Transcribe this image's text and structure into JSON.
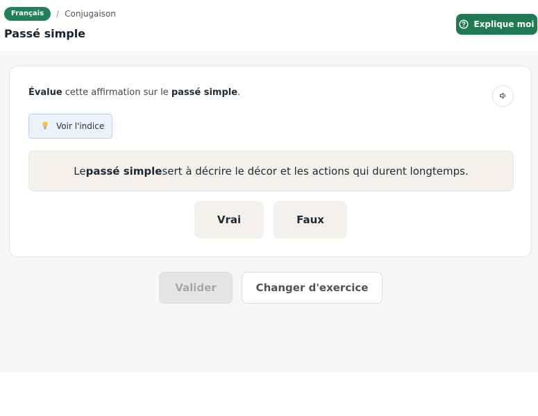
{
  "header": {
    "breadcrumb": {
      "subject": "Français",
      "separator": "/",
      "current": "Conjugaison"
    },
    "title": "Passé simple",
    "explain_button": {
      "label": "Explique moi",
      "icon": "help-circle-icon"
    }
  },
  "exercise": {
    "instruction": {
      "part1": "Évalue",
      "part2": " cette affirmation sur le ",
      "part3": "passé simple",
      "part4": "."
    },
    "audio_button": {
      "icon": "speaker-icon"
    },
    "hint_button": {
      "label": "Voir l'indice",
      "icon": "lightbulb-icon"
    },
    "statement": {
      "part1": "Le ",
      "part2": "passé simple",
      "part3": " sert à décrire le décor et les actions qui durent longtemps."
    },
    "answers": {
      "true_label": "Vrai",
      "false_label": "Faux"
    }
  },
  "actions": {
    "validate_label": "Valider",
    "validate_state": "disabled",
    "change_label": "Changer d'exercice"
  },
  "colors": {
    "brand_green": "#23805a",
    "explain_green": "#1f7a52",
    "main_background": "#f8f7f5",
    "statement_background": "#f4f1ec",
    "hint_background": "#eaf2fc"
  }
}
